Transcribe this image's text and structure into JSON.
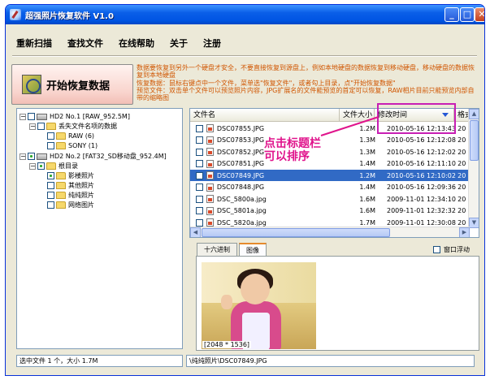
{
  "window": {
    "title": "超强照片恢复软件 V1.0",
    "controls": {
      "minimize": "_",
      "maximize": "□",
      "close": "✕"
    }
  },
  "menu": [
    "重新扫描",
    "查找文件",
    "在线帮助",
    "关于",
    "注册"
  ],
  "start_button": {
    "label": "开始恢复数据",
    "icon": "recover-icon"
  },
  "notes": [
    "数据要恢复到另外一个硬盘才安全，不要直接恢复到源盘上，例如本地硬盘的数据恢复到移动硬盘，移动硬盘的数据恢复到本地硬盘",
    "恢复数据：鼠标右键点中一个文件，菜单选\"恢复文件\"，或者勾上目录，点\"开始恢复数据\"",
    "预览文件：双击单个文件可以预览照片内容，JPG扩展名的文件能预览的首定可以恢复，RAW相片目前只能预览内部自带的缩略图"
  ],
  "tree": [
    {
      "label": "HD2 No.1 [RAW_952.5M]",
      "expander": "−",
      "type": "drive",
      "checked": false
    },
    {
      "label": "丢失文件名项的数据",
      "expander": "−",
      "type": "folder",
      "checked": false
    },
    {
      "label": "RAW (6)",
      "expander": "",
      "type": "folder",
      "checked": false
    },
    {
      "label": "SONY (1)",
      "expander": "",
      "type": "folder",
      "checked": false
    },
    {
      "label": "HD2 No.2 [FAT32_SD移动盘_952.4M]",
      "expander": "−",
      "type": "drive",
      "checked": "partial"
    },
    {
      "label": "根目录",
      "expander": "−",
      "type": "folder",
      "checked": "partial"
    },
    {
      "label": "影楼照片",
      "expander": "",
      "type": "folder",
      "checked": "partial"
    },
    {
      "label": "其他照片",
      "expander": "",
      "type": "folder",
      "checked": false
    },
    {
      "label": "纯纯照片",
      "expander": "",
      "type": "folder",
      "checked": false
    },
    {
      "label": "网络图片",
      "expander": "",
      "type": "folder",
      "checked": false
    }
  ],
  "list": {
    "columns": [
      "文件名",
      "文件大小",
      "修改时间",
      "格式"
    ],
    "rows": [
      {
        "name": "DSC07855.JPG",
        "size": "1.2M",
        "date": "2010-05-16 12:13:43",
        "extra": "20",
        "selected": false
      },
      {
        "name": "DSC07853.JPG",
        "size": "1.3M",
        "date": "2010-05-16 12:12:08",
        "extra": "20",
        "selected": false
      },
      {
        "name": "DSC07852.JPG",
        "size": "1.3M",
        "date": "2010-05-16 12:12:02",
        "extra": "20",
        "selected": false
      },
      {
        "name": "DSC07851.JPG",
        "size": "1.4M",
        "date": "2010-05-16 12:11:10",
        "extra": "20",
        "selected": false
      },
      {
        "name": "DSC07849.JPG",
        "size": "1.2M",
        "date": "2010-05-16 12:10:02",
        "extra": "20",
        "selected": true
      },
      {
        "name": "DSC07848.JPG",
        "size": "1.4M",
        "date": "2010-05-16 12:09:36",
        "extra": "20",
        "selected": false
      },
      {
        "name": "DSC_5800a.jpg",
        "size": "1.6M",
        "date": "2009-11-01 12:34:10",
        "extra": "20",
        "selected": false
      },
      {
        "name": "DSC_5801a.jpg",
        "size": "1.6M",
        "date": "2009-11-01 12:32:32",
        "extra": "20",
        "selected": false
      },
      {
        "name": "DSC_5820a.jpg",
        "size": "1.7M",
        "date": "2009-11-01 12:30:08",
        "extra": "20",
        "selected": false
      }
    ]
  },
  "annotation": {
    "text": "点击标题栏\n可以排序",
    "color": "#E0148C"
  },
  "tabs": [
    "十六进制",
    "图像"
  ],
  "float_window": "窗口浮动",
  "preview": {
    "size": "[2048 * 1536]"
  },
  "status": {
    "left": "选中文件 1 个，大小 1.7M",
    "right": "\\纯纯照片\\DSC07849.JPG"
  },
  "colors": {
    "title_bar": "#0054E3",
    "selection": "#316AC5",
    "notes": "#D05500",
    "annotation": "#E0148C"
  }
}
